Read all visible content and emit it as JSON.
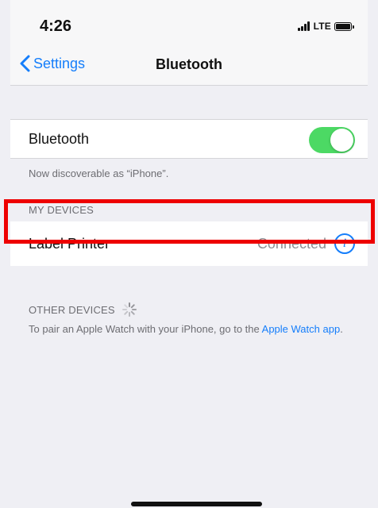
{
  "status_bar": {
    "time": "4:26",
    "network": "LTE"
  },
  "nav": {
    "back_label": "Settings",
    "title": "Bluetooth"
  },
  "bluetooth_row": {
    "label": "Bluetooth",
    "enabled": true
  },
  "discoverable_note": "Now discoverable as “iPhone”.",
  "my_devices": {
    "header": "MY DEVICES",
    "items": [
      {
        "name": "Label Printer",
        "status": "Connected"
      }
    ]
  },
  "other_devices": {
    "header": "OTHER DEVICES",
    "note_text": "To pair an Apple Watch with your iPhone, go to the",
    "note_link": "Apple Watch app",
    "note_end": "."
  },
  "colors": {
    "accent": "#157efb",
    "toggle_on": "#4cd964",
    "highlight": "#ee0000",
    "grouped_background": "#efeff4"
  }
}
